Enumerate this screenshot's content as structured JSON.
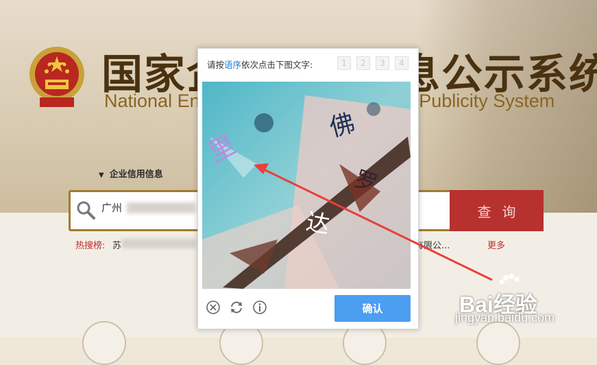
{
  "page": {
    "title_cn": "国家企业信用信息公示系统",
    "title_en": "National Enterprise Credit Information Publicity System"
  },
  "search": {
    "tab": "企业信用信息",
    "value": "广州",
    "button": "查询"
  },
  "hot_search": {
    "label": "热搜榜:",
    "item1": "苏",
    "item2": "有限公...",
    "more": "更多"
  },
  "captcha": {
    "prompt_prefix": "请按",
    "prompt_highlight": "语序",
    "prompt_suffix": "依次点击下图文字:",
    "order_slots": [
      "1",
      "2",
      "3",
      "4"
    ],
    "chars": [
      "佛",
      "罗",
      "达",
      "里"
    ],
    "confirm": "确认",
    "close_icon": "close-icon",
    "refresh_icon": "refresh-icon",
    "info_icon": "info-icon"
  },
  "watermark": {
    "brand": "Bai经验",
    "url": "jingyan.baidu.com"
  },
  "colors": {
    "accent_blue": "#4c9ef0",
    "query_red": "#b7312f",
    "title_brown": "#4a3210",
    "arrow_red": "#e8403a"
  }
}
